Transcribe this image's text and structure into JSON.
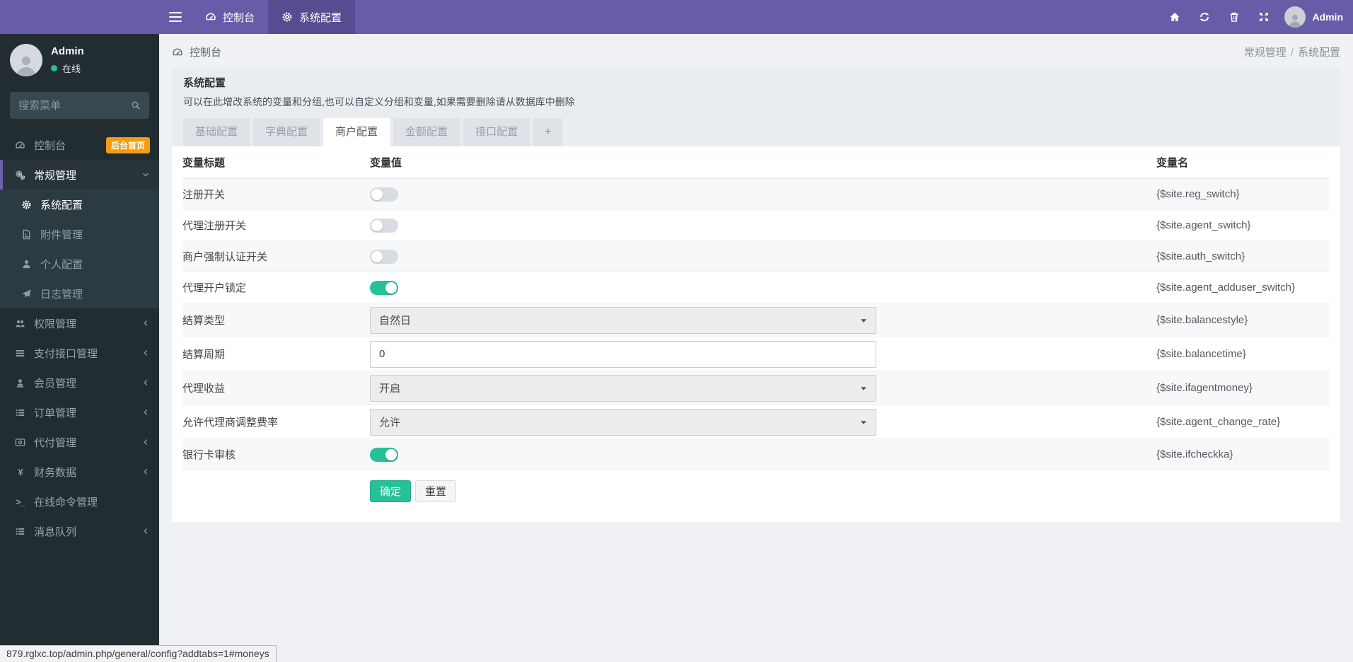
{
  "topbar": {
    "nav": [
      {
        "label": "控制台",
        "icon": "dashboard",
        "active": false
      },
      {
        "label": "系统配置",
        "icon": "gear",
        "active": true
      }
    ],
    "actions": [
      {
        "icon": "home"
      },
      {
        "icon": "refresh"
      },
      {
        "icon": "trash"
      },
      {
        "icon": "expand"
      }
    ],
    "user": {
      "name": "Admin"
    }
  },
  "sidebar": {
    "user": {
      "name": "Admin",
      "status": "在线"
    },
    "search_placeholder": "搜索菜单",
    "menu": [
      {
        "label": "控制台",
        "icon": "dashboard",
        "badge": "后台首页"
      },
      {
        "label": "常规管理",
        "icon": "gears",
        "state": "open",
        "chevron": "down",
        "children": [
          {
            "label": "系统配置",
            "icon": "gear",
            "active": true
          },
          {
            "label": "附件管理",
            "icon": "file-image"
          },
          {
            "label": "个人配置",
            "icon": "user"
          },
          {
            "label": "日志管理",
            "icon": "paper-plane"
          }
        ]
      },
      {
        "label": "权限管理",
        "icon": "users",
        "chevron": "left"
      },
      {
        "label": "支付接口管理",
        "icon": "list",
        "chevron": "left"
      },
      {
        "label": "会员管理",
        "icon": "member",
        "chevron": "left"
      },
      {
        "label": "订单管理",
        "icon": "list-alt",
        "chevron": "left"
      },
      {
        "label": "代付管理",
        "icon": "credit-card",
        "chevron": "left"
      },
      {
        "label": "财务数据",
        "icon": "yen",
        "chevron": "left"
      },
      {
        "label": "在线命令管理",
        "icon": "terminal"
      },
      {
        "label": "消息队列",
        "icon": "list-alt",
        "chevron": "left"
      }
    ]
  },
  "breadcrumb": {
    "section": "控制台",
    "trail": [
      "常规管理",
      "系统配置"
    ],
    "separator": "/"
  },
  "panel": {
    "title": "系统配置",
    "description": "可以在此增改系统的变量和分组,也可以自定义分组和变量,如果需要删除请从数据库中删除",
    "tabs": [
      {
        "label": "基础配置"
      },
      {
        "label": "字典配置"
      },
      {
        "label": "商户配置",
        "active": true
      },
      {
        "label": "金额配置"
      },
      {
        "label": "接口配置"
      },
      {
        "label": "+",
        "add": true
      }
    ]
  },
  "config_table": {
    "headers": [
      "变量标题",
      "变量值",
      "变量名"
    ],
    "rows": [
      {
        "title": "注册开关",
        "control": "toggle",
        "value": false,
        "var": "{$site.reg_switch}"
      },
      {
        "title": "代理注册开关",
        "control": "toggle",
        "value": false,
        "var": "{$site.agent_switch}"
      },
      {
        "title": "商户强制认证开关",
        "control": "toggle",
        "value": false,
        "var": "{$site.auth_switch}"
      },
      {
        "title": "代理开户锁定",
        "control": "toggle",
        "value": true,
        "var": "{$site.agent_adduser_switch}"
      },
      {
        "title": "结算类型",
        "control": "select",
        "value": "自然日",
        "var": "{$site.balancestyle}"
      },
      {
        "title": "结算周期",
        "control": "input",
        "value": "0",
        "var": "{$site.balancetime}"
      },
      {
        "title": "代理收益",
        "control": "select",
        "value": "开启",
        "var": "{$site.ifagentmoney}"
      },
      {
        "title": "允许代理商调整费率",
        "control": "select",
        "value": "允许",
        "var": "{$site.agent_change_rate}"
      },
      {
        "title": "银行卡审核",
        "control": "toggle",
        "value": true,
        "var": "{$site.ifcheckka}"
      }
    ],
    "buttons": {
      "submit": "确定",
      "reset": "重置"
    }
  },
  "statusbar": {
    "url": "879.rglxc.top/admin.php/general/config?addtabs=1#moneys"
  },
  "colors": {
    "navbar": "#685ca8",
    "navbar_active": "#564c90",
    "sidebar": "#222d32",
    "submenu": "#2c3b41",
    "accent_green": "#26c196",
    "badge_orange": "#f39c12"
  }
}
